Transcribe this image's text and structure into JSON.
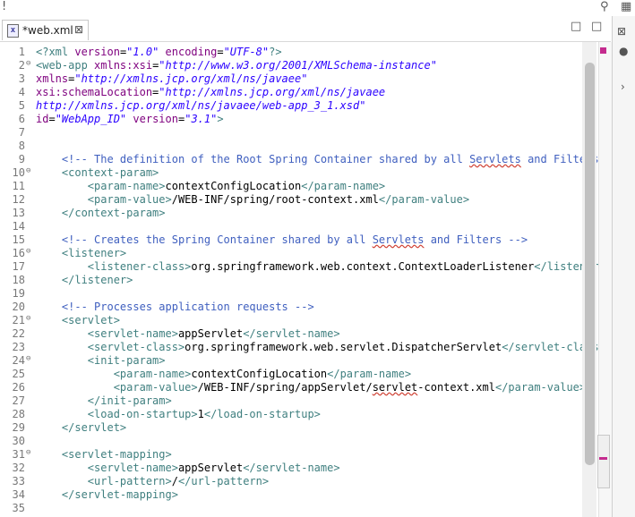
{
  "window": {
    "search_icon": "search-icon"
  },
  "tab": {
    "title": "*web.xml",
    "close_glyph": "⊠",
    "file_icon_glyph": "x"
  },
  "view_controls": {
    "minimize": "□",
    "maximize": "□",
    "close_panel": "⊠"
  },
  "side_panel": {
    "chevron": "›"
  },
  "editor": {
    "lines": [
      {
        "n": "1",
        "fold": "",
        "segs": [
          [
            "tg",
            "<?xml "
          ],
          [
            "at",
            "version"
          ],
          [
            "tx",
            "="
          ],
          [
            "st",
            "\"1.0\""
          ],
          [
            "tx",
            " "
          ],
          [
            "at",
            "encoding"
          ],
          [
            "tx",
            "="
          ],
          [
            "st",
            "\"UTF-8\""
          ],
          [
            "tg",
            "?>"
          ]
        ]
      },
      {
        "n": "2",
        "fold": "⊖",
        "segs": [
          [
            "tg",
            "<web-app "
          ],
          [
            "at",
            "xmlns:xsi"
          ],
          [
            "tx",
            "="
          ],
          [
            "st",
            "\"http://www.w3.org/2001/XMLSchema-instance\""
          ]
        ]
      },
      {
        "n": "3",
        "fold": "",
        "segs": [
          [
            "at",
            "xmlns"
          ],
          [
            "tx",
            "="
          ],
          [
            "st",
            "\"http://xmlns.jcp.org/xml/ns/javaee\""
          ]
        ]
      },
      {
        "n": "4",
        "fold": "",
        "segs": [
          [
            "at",
            "xsi:schemaLocation"
          ],
          [
            "tx",
            "="
          ],
          [
            "st",
            "\"http://xmlns.jcp.org/xml/ns/javaee"
          ]
        ]
      },
      {
        "n": "5",
        "fold": "",
        "segs": [
          [
            "st",
            "http://xmlns.jcp.org/xml/ns/javaee/web-app_3_1.xsd\""
          ]
        ]
      },
      {
        "n": "6",
        "fold": "",
        "segs": [
          [
            "at",
            "id"
          ],
          [
            "tx",
            "="
          ],
          [
            "st",
            "\"WebApp_ID\""
          ],
          [
            "tx",
            " "
          ],
          [
            "at",
            "version"
          ],
          [
            "tx",
            "="
          ],
          [
            "st",
            "\"3.1\""
          ],
          [
            "tg",
            ">"
          ]
        ]
      },
      {
        "n": "7",
        "fold": "",
        "segs": []
      },
      {
        "n": "8",
        "fold": "",
        "segs": []
      },
      {
        "n": "9",
        "fold": "",
        "segs": [
          [
            "tx",
            "    "
          ],
          [
            "cm",
            "<!-- The definition of the Root Spring Container shared by all "
          ],
          [
            "cms",
            "Servlets"
          ],
          [
            "cm",
            " and Filters"
          ]
        ]
      },
      {
        "n": "10",
        "fold": "⊖",
        "segs": [
          [
            "tx",
            "    "
          ],
          [
            "tg",
            "<context-param>"
          ]
        ]
      },
      {
        "n": "11",
        "fold": "",
        "segs": [
          [
            "tx",
            "        "
          ],
          [
            "tg",
            "<param-name>"
          ],
          [
            "tx",
            "contextConfigLocation"
          ],
          [
            "tg",
            "</param-name>"
          ]
        ]
      },
      {
        "n": "12",
        "fold": "",
        "segs": [
          [
            "tx",
            "        "
          ],
          [
            "tg",
            "<param-value>"
          ],
          [
            "tx",
            "/WEB-INF/spring/root-context.xml"
          ],
          [
            "tg",
            "</param-value>"
          ]
        ]
      },
      {
        "n": "13",
        "fold": "",
        "segs": [
          [
            "tx",
            "    "
          ],
          [
            "tg",
            "</context-param>"
          ]
        ]
      },
      {
        "n": "14",
        "fold": "",
        "segs": []
      },
      {
        "n": "15",
        "fold": "",
        "segs": [
          [
            "tx",
            "    "
          ],
          [
            "cm",
            "<!-- Creates the Spring Container shared by all "
          ],
          [
            "cms",
            "Servlets"
          ],
          [
            "cm",
            " and Filters -->"
          ]
        ]
      },
      {
        "n": "16",
        "fold": "⊖",
        "segs": [
          [
            "tx",
            "    "
          ],
          [
            "tg",
            "<listener>"
          ]
        ]
      },
      {
        "n": "17",
        "fold": "",
        "segs": [
          [
            "tx",
            "        "
          ],
          [
            "tg",
            "<listener-class>"
          ],
          [
            "tx",
            "org.springframework.web.context.ContextLoaderListener"
          ],
          [
            "tg",
            "</listener"
          ]
        ]
      },
      {
        "n": "18",
        "fold": "",
        "segs": [
          [
            "tx",
            "    "
          ],
          [
            "tg",
            "</listener>"
          ]
        ]
      },
      {
        "n": "19",
        "fold": "",
        "segs": []
      },
      {
        "n": "20",
        "fold": "",
        "segs": [
          [
            "tx",
            "    "
          ],
          [
            "cm",
            "<!-- Processes application requests -->"
          ]
        ]
      },
      {
        "n": "21",
        "fold": "⊖",
        "segs": [
          [
            "tx",
            "    "
          ],
          [
            "tg",
            "<servlet>"
          ]
        ]
      },
      {
        "n": "22",
        "fold": "",
        "segs": [
          [
            "tx",
            "        "
          ],
          [
            "tg",
            "<servlet-name>"
          ],
          [
            "tx",
            "appServlet"
          ],
          [
            "tg",
            "</servlet-name>"
          ]
        ]
      },
      {
        "n": "23",
        "fold": "",
        "segs": [
          [
            "tx",
            "        "
          ],
          [
            "tg",
            "<servlet-class>"
          ],
          [
            "tx",
            "org.springframework.web.servlet.DispatcherServlet"
          ],
          [
            "tg",
            "</servlet-class"
          ]
        ]
      },
      {
        "n": "24",
        "fold": "⊖",
        "segs": [
          [
            "tx",
            "        "
          ],
          [
            "tg",
            "<init-param>"
          ]
        ]
      },
      {
        "n": "25",
        "fold": "",
        "segs": [
          [
            "tx",
            "            "
          ],
          [
            "tg",
            "<param-name>"
          ],
          [
            "tx",
            "contextConfigLocation"
          ],
          [
            "tg",
            "</param-name>"
          ]
        ]
      },
      {
        "n": "26",
        "fold": "",
        "segs": [
          [
            "tx",
            "            "
          ],
          [
            "tg",
            "<param-value>"
          ],
          [
            "tx",
            "/WEB-INF/spring/appServlet/"
          ],
          [
            "txs",
            "servlet"
          ],
          [
            "tx",
            "-context.xml"
          ],
          [
            "tg",
            "</param-value>"
          ]
        ]
      },
      {
        "n": "27",
        "fold": "",
        "segs": [
          [
            "tx",
            "        "
          ],
          [
            "tg",
            "</init-param>"
          ]
        ]
      },
      {
        "n": "28",
        "fold": "",
        "segs": [
          [
            "tx",
            "        "
          ],
          [
            "tg",
            "<load-on-startup>"
          ],
          [
            "tx",
            "1"
          ],
          [
            "tg",
            "</load-on-startup>"
          ]
        ]
      },
      {
        "n": "29",
        "fold": "",
        "segs": [
          [
            "tx",
            "    "
          ],
          [
            "tg",
            "</servlet>"
          ]
        ]
      },
      {
        "n": "30",
        "fold": "",
        "segs": []
      },
      {
        "n": "31",
        "fold": "⊖",
        "segs": [
          [
            "tx",
            "    "
          ],
          [
            "tg",
            "<servlet-mapping>"
          ]
        ]
      },
      {
        "n": "32",
        "fold": "",
        "segs": [
          [
            "tx",
            "        "
          ],
          [
            "tg",
            "<servlet-name>"
          ],
          [
            "tx",
            "appServlet"
          ],
          [
            "tg",
            "</servlet-name>"
          ]
        ]
      },
      {
        "n": "33",
        "fold": "",
        "segs": [
          [
            "tx",
            "        "
          ],
          [
            "tg",
            "<url-pattern>"
          ],
          [
            "tx",
            "/"
          ],
          [
            "tg",
            "</url-pattern>"
          ]
        ]
      },
      {
        "n": "34",
        "fold": "",
        "segs": [
          [
            "tx",
            "    "
          ],
          [
            "tg",
            "</servlet-mapping>"
          ]
        ]
      },
      {
        "n": "35",
        "fold": "",
        "segs": []
      }
    ]
  },
  "colors": {
    "comment": "#3f5fbf",
    "tag": "#3f7f7f",
    "attr": "#7f007f",
    "string": "#2a00ff",
    "marker": "#c42b8e"
  }
}
